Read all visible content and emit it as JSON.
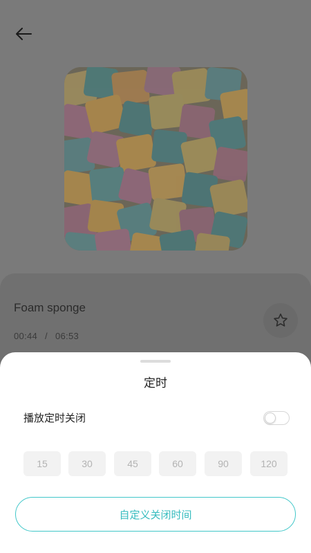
{
  "header": {
    "back_icon": "arrow-left-icon"
  },
  "track": {
    "title": "Foam sponge",
    "current_time": "00:44",
    "separator": "/",
    "duration": "06:53",
    "favorite_icon": "star-outline-icon"
  },
  "timer_sheet": {
    "title": "定时",
    "toggle_label": "播放定时关闭",
    "toggle_on": false,
    "presets": [
      "15",
      "30",
      "45",
      "60",
      "90",
      "120"
    ],
    "custom_button_label": "自定义关闭时间"
  },
  "colors": {
    "accent": "#41c7c9",
    "overlay": "#7a7a7a",
    "sheet_bg": "#ffffff",
    "preset_bg": "#f2f2f2",
    "preset_text": "#b3b3b3"
  }
}
